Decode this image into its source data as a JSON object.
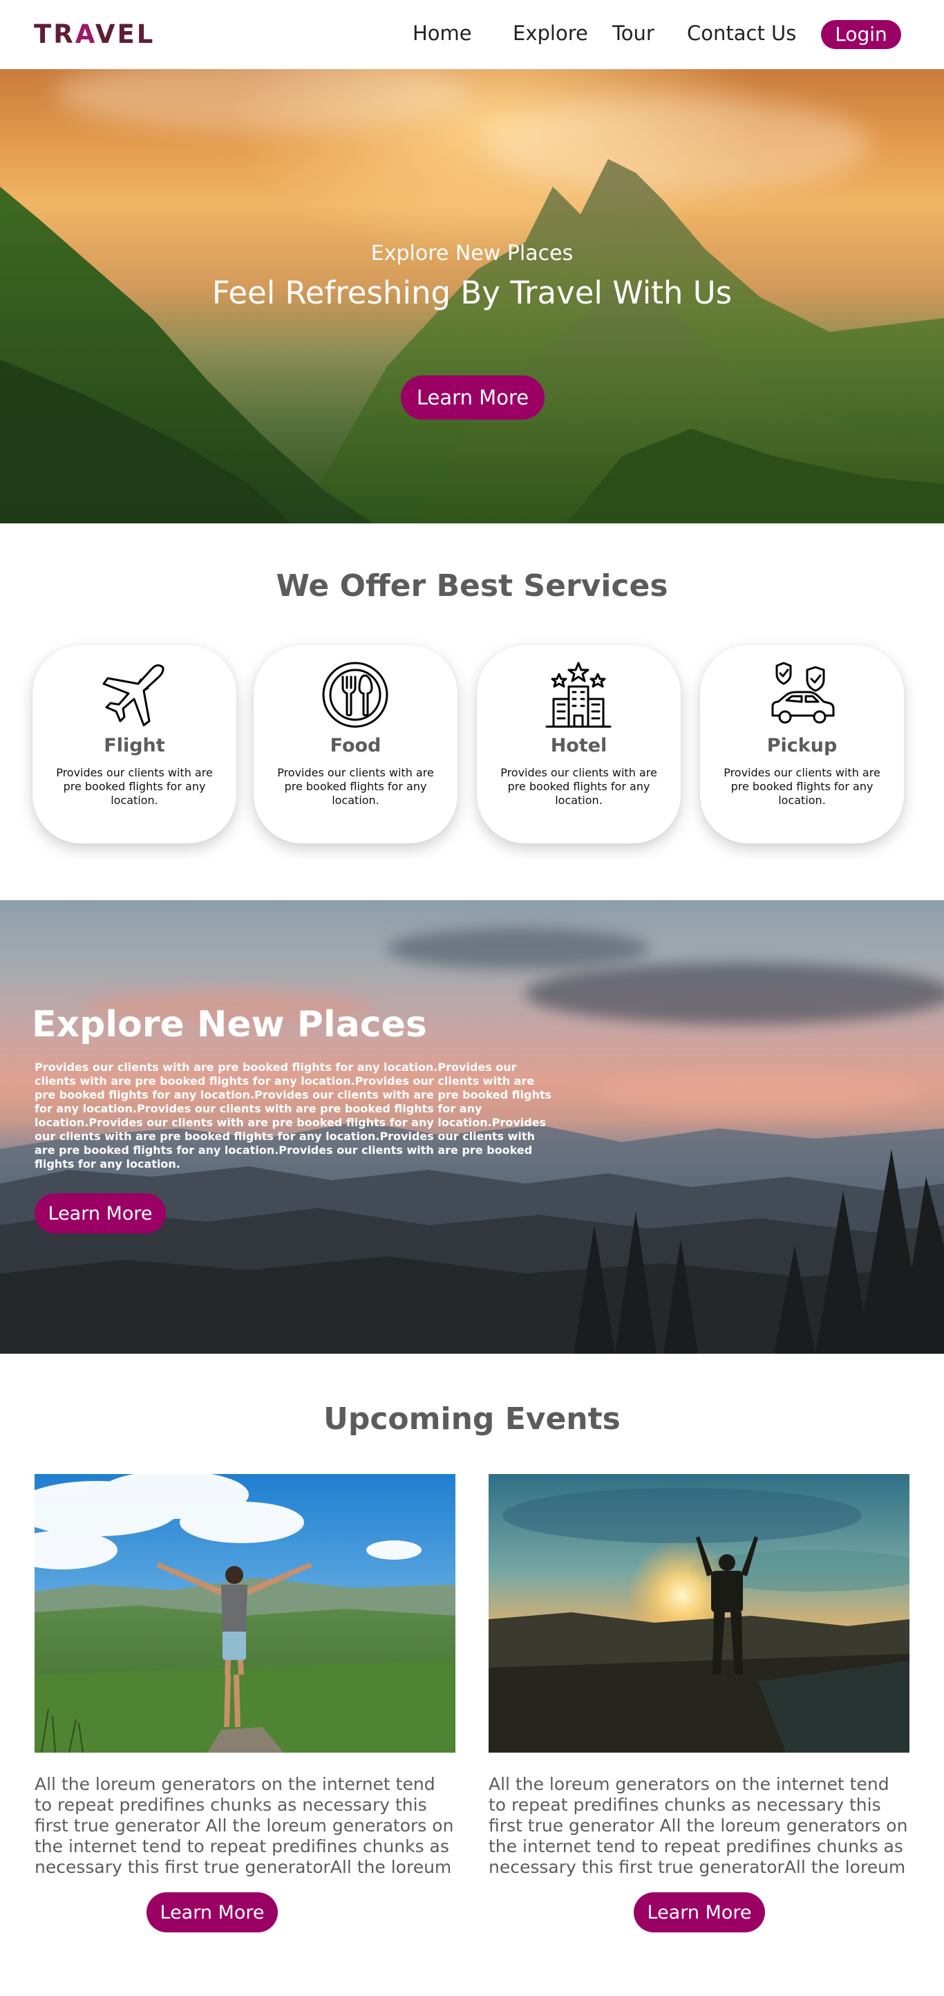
{
  "nav": {
    "logo_prefix": "TR",
    "logo_accent": "A",
    "logo_suffix": "VEL",
    "links": [
      "Home",
      "Explore",
      "Tour",
      "Contact Us"
    ],
    "login_label": "Login",
    "brand_color": "#5e1f33",
    "accent_color": "#9b0064"
  },
  "hero": {
    "subtitle": "Explore New Places",
    "title": "Feel Refreshing By Travel With Us",
    "button_label": "Learn More"
  },
  "services": {
    "title": "We Offer Best Services",
    "items": [
      {
        "name": "Flight",
        "icon": "airplane-icon",
        "description": "Provides our clients with are pre booked flights for any location."
      },
      {
        "name": "Food",
        "icon": "plate-cutlery-icon",
        "description": "Provides our clients with are pre booked flights for any location."
      },
      {
        "name": "Hotel",
        "icon": "hotel-building-icon",
        "description": "Provides our clients with are pre booked flights for any location."
      },
      {
        "name": "Pickup",
        "icon": "car-shield-icon",
        "description": "Provides our clients with are pre booked flights for any location."
      }
    ]
  },
  "explore": {
    "title": "Explore New Places",
    "text": "Provides our clients with are pre booked flights for any location.Provides our clients with are pre booked flights for any location.Provides our clients with are pre booked flights for any location.Provides our clients with are pre booked flights for any location.Provides our clients with are pre booked flights for any location.Provides our clients with are pre booked flights for any location.Provides our clients with are pre booked flights for any location.Provides our clients with are pre booked flights for any location.Provides our clients with are pre booked flights for any location.",
    "button_label": "Learn More"
  },
  "events": {
    "title": "Upcoming Events",
    "items": [
      {
        "text": "All the loreum generators on the internet tend to repeat predifines chunks as necessary this first true generator All the loreum generators on the internet tend to repeat predifines chunks as necessary this first true generatorAll the loreum",
        "button_label": "Learn More"
      },
      {
        "text": "All the loreum generators on the internet tend to repeat predifines chunks as necessary this first true generator All the loreum generators on the internet tend to repeat predifines chunks as necessary this first true generatorAll the loreum",
        "button_label": "Learn More"
      }
    ]
  }
}
